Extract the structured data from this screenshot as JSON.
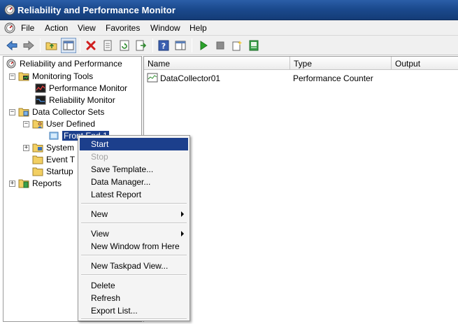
{
  "window": {
    "title": "Reliability and Performance Monitor"
  },
  "menu": [
    "File",
    "Action",
    "View",
    "Favorites",
    "Window",
    "Help"
  ],
  "toolbar": {
    "buttons": [
      "back-arrow-icon",
      "forward-arrow-icon",
      "up-folder-icon",
      "show-hide-tree-icon",
      "delete-icon",
      "properties-icon",
      "refresh-icon",
      "export-list-icon",
      "help-icon",
      "show-hide-action-pane-icon",
      "start-icon",
      "stop-icon",
      "new-icon",
      "latest-report-icon"
    ]
  },
  "tree": {
    "root": "Reliability and Performance",
    "monitoring_tools": "Monitoring Tools",
    "performance_monitor": "Performance Monitor",
    "reliability_monitor": "Reliability Monitor",
    "data_collector_sets": "Data Collector Sets",
    "user_defined": "User Defined",
    "front_end": "Front End 1",
    "system": "System",
    "event_trace": "Event T",
    "startup": "Startup",
    "reports": "Reports"
  },
  "list": {
    "columns": [
      "Name",
      "Type",
      "Output"
    ],
    "rows": [
      {
        "name": "DataCollector01",
        "type": "Performance Counter",
        "output": ""
      }
    ]
  },
  "context_menu": {
    "start": "Start",
    "stop": "Stop",
    "save_template": "Save Template...",
    "data_manager": "Data Manager...",
    "latest_report": "Latest Report",
    "new": "New",
    "view": "View",
    "new_window": "New Window from Here",
    "new_taskpad": "New Taskpad View...",
    "delete": "Delete",
    "refresh": "Refresh",
    "export_list": "Export List..."
  },
  "colors": {
    "titlebar": "#1b4a8e",
    "selection": "#1c3f8c",
    "start_green": "#2aa32a",
    "delete_red": "#d01e1e"
  }
}
